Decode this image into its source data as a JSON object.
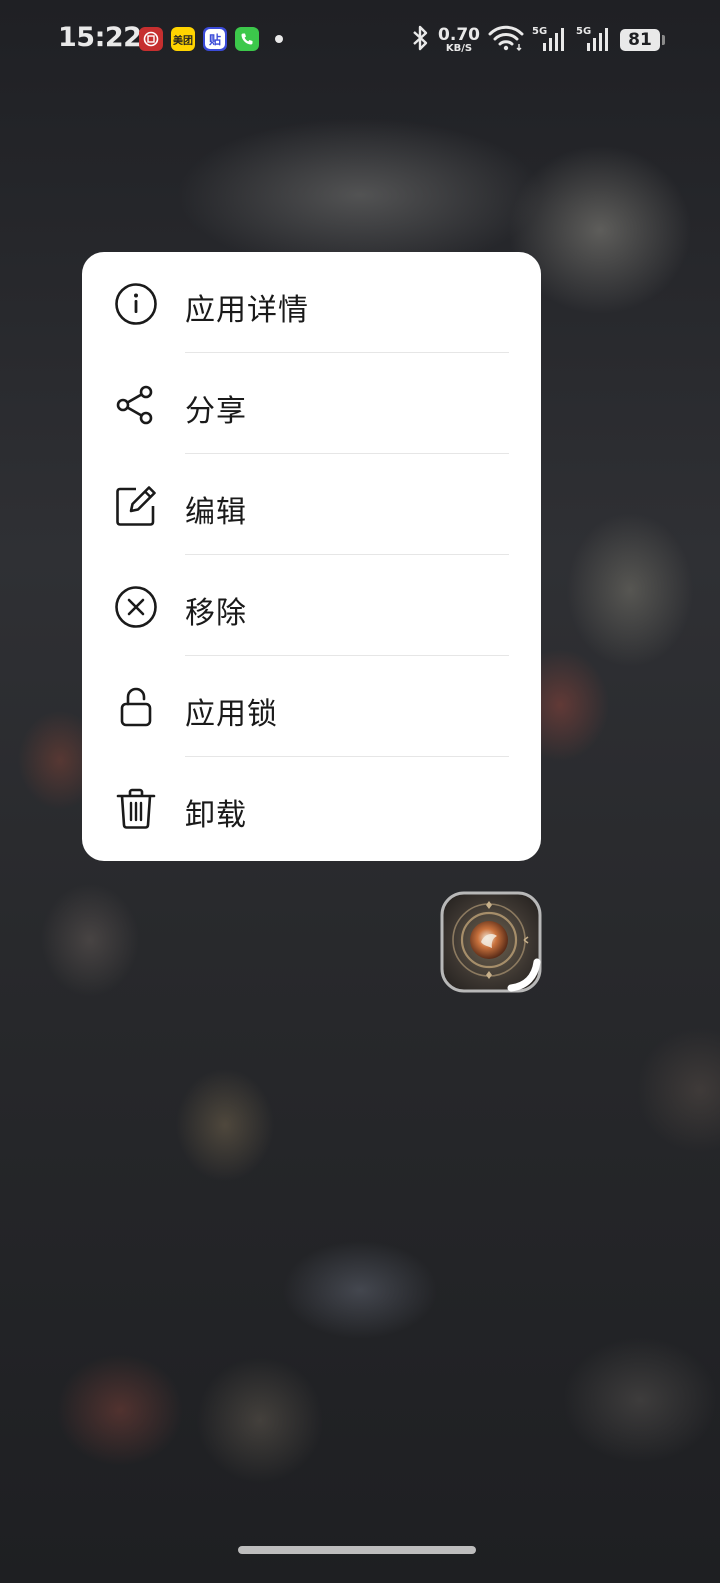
{
  "status_bar": {
    "time": "15:22",
    "notifications": [
      {
        "icon": "bank-app-icon",
        "text": "",
        "color": "#c62f2f"
      },
      {
        "icon": "meituan-app-icon",
        "text": "美团",
        "color": "#ffd400"
      },
      {
        "icon": "tieba-app-icon",
        "text": "贴",
        "color": "#3b4bd8"
      },
      {
        "icon": "phone-app-icon",
        "text": "",
        "color": "#3cc84b"
      }
    ],
    "net_speed_value": "0.70",
    "net_speed_unit": "KB/S",
    "signal_1_label": "5G",
    "signal_2_label": "5G",
    "battery": "81"
  },
  "menu": {
    "items": [
      {
        "label": "应用详情",
        "icon": "info-icon"
      },
      {
        "label": "分享",
        "icon": "share-icon"
      },
      {
        "label": "编辑",
        "icon": "edit-icon"
      },
      {
        "label": "移除",
        "icon": "remove-icon"
      },
      {
        "label": "应用锁",
        "icon": "lock-icon"
      },
      {
        "label": "卸载",
        "icon": "trash-icon"
      }
    ]
  }
}
